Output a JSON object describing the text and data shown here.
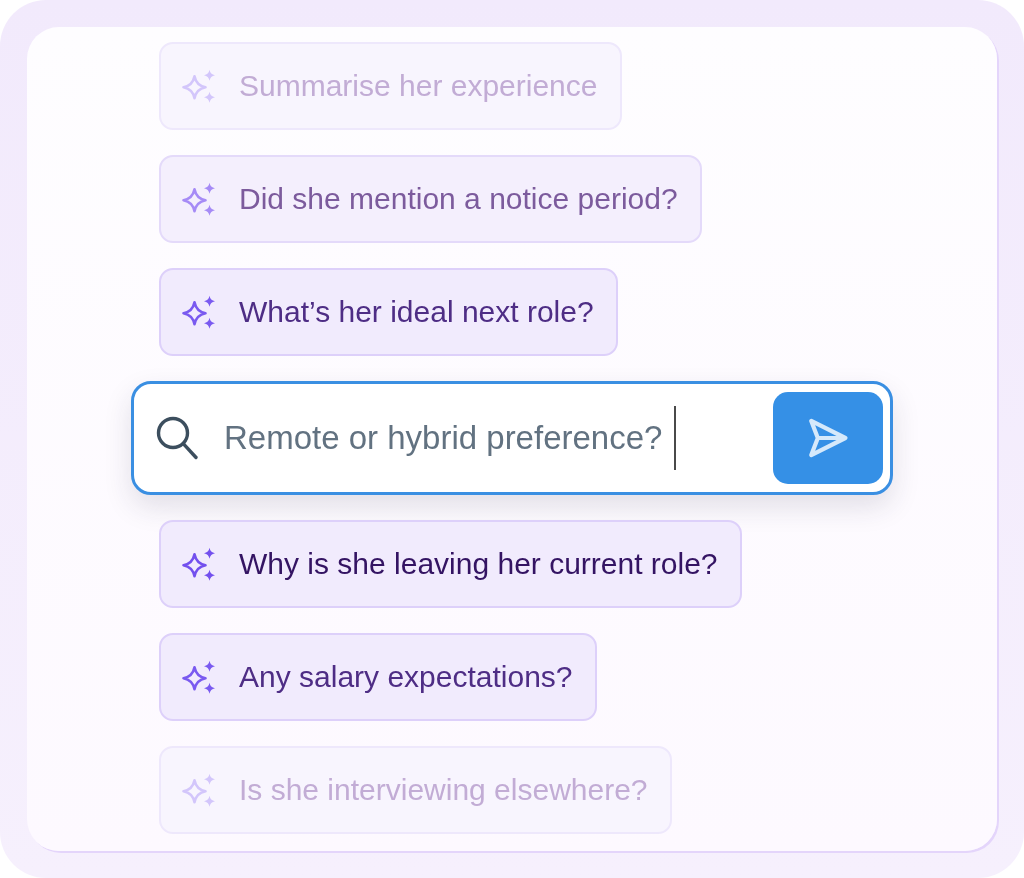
{
  "suggestions_above": [
    {
      "text": "Summarise her experience",
      "kind": "faint"
    },
    {
      "text": "Did she mention a notice period?",
      "kind": "medium"
    },
    {
      "text": "What’s her ideal next role?",
      "kind": "strong"
    }
  ],
  "search": {
    "value": "Remote or hybrid preference?"
  },
  "suggestions_below": [
    {
      "text": "Why is she leaving her current role?",
      "kind": "deep"
    },
    {
      "text": "Any salary expectations?",
      "kind": "strong"
    },
    {
      "text": "Is she interviewing elsewhere?",
      "kind": "faint"
    }
  ]
}
